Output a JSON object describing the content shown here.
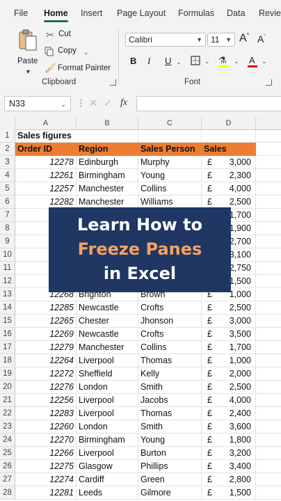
{
  "ribbon": {
    "tabs": [
      "File",
      "Home",
      "Insert",
      "Page Layout",
      "Formulas",
      "Data",
      "Review"
    ],
    "active_tab": "Home",
    "clipboard": {
      "paste_label": "Paste",
      "cut_label": "Cut",
      "copy_label": "Copy",
      "format_painter_label": "Format Painter",
      "group_label": "Clipboard"
    },
    "font": {
      "font_name": "Calibri",
      "font_size": "11",
      "group_label": "Font",
      "bold": "B",
      "italic": "I",
      "underline": "U",
      "grow": "A",
      "shrink": "A"
    }
  },
  "formula_bar": {
    "name_box": "N33",
    "fx": "fx",
    "formula": ""
  },
  "grid": {
    "columns": [
      "A",
      "B",
      "C",
      "D"
    ],
    "title": "Sales figures",
    "headers": [
      "Order ID",
      "Region",
      "Sales Person",
      "Sales"
    ],
    "currency_symbol": "£",
    "rows": [
      {
        "num": "3",
        "id": "12278",
        "region": "Edinburgh",
        "person": "Murphy",
        "sales": "3,000"
      },
      {
        "num": "4",
        "id": "12261",
        "region": "Birmingham",
        "person": "Young",
        "sales": "2,300"
      },
      {
        "num": "5",
        "id": "12257",
        "region": "Manchester",
        "person": "Collins",
        "sales": "4,000"
      },
      {
        "num": "6",
        "id": "12282",
        "region": "Manchester",
        "person": "Williams",
        "sales": "2,500"
      },
      {
        "num": "7",
        "id": "",
        "region": "",
        "person": "",
        "sales": "1,700"
      },
      {
        "num": "8",
        "id": "",
        "region": "",
        "person": "",
        "sales": "1,900"
      },
      {
        "num": "9",
        "id": "",
        "region": "",
        "person": "",
        "sales": "2,700"
      },
      {
        "num": "10",
        "id": "",
        "region": "",
        "person": "",
        "sales": "3,100"
      },
      {
        "num": "11",
        "id": "",
        "region": "",
        "person": "",
        "sales": "2,750"
      },
      {
        "num": "12",
        "id": "",
        "region": "",
        "person": "",
        "sales": "1,500"
      },
      {
        "num": "13",
        "id": "12268",
        "region": "Brighton",
        "person": "Brown",
        "sales": "1,000"
      },
      {
        "num": "14",
        "id": "12285",
        "region": "Newcastle",
        "person": "Crofts",
        "sales": "2,500"
      },
      {
        "num": "15",
        "id": "12265",
        "region": "Chester",
        "person": "Jhonson",
        "sales": "3,000"
      },
      {
        "num": "16",
        "id": "12269",
        "region": "Newcastle",
        "person": "Crofts",
        "sales": "3,500"
      },
      {
        "num": "17",
        "id": "12279",
        "region": "Manchester",
        "person": "Collins",
        "sales": "1,700"
      },
      {
        "num": "18",
        "id": "12264",
        "region": "Liverpool",
        "person": "Thomas",
        "sales": "1,000"
      },
      {
        "num": "19",
        "id": "12272",
        "region": "Sheffield",
        "person": "Kelly",
        "sales": "2,000"
      },
      {
        "num": "20",
        "id": "12276",
        "region": "London",
        "person": "Smith",
        "sales": "2,500"
      },
      {
        "num": "21",
        "id": "12256",
        "region": "Liverpool",
        "person": "Jacobs",
        "sales": "4,000"
      },
      {
        "num": "22",
        "id": "12283",
        "region": "Liverpool",
        "person": "Thomas",
        "sales": "2,400"
      },
      {
        "num": "23",
        "id": "12260",
        "region": "London",
        "person": "Smith",
        "sales": "3,600"
      },
      {
        "num": "24",
        "id": "12270",
        "region": "Birmingham",
        "person": "Young",
        "sales": "1,800"
      },
      {
        "num": "25",
        "id": "12266",
        "region": "Liverpool",
        "person": "Burton",
        "sales": "3,200"
      },
      {
        "num": "26",
        "id": "12275",
        "region": "Glasgow",
        "person": "Phillips",
        "sales": "3,400"
      },
      {
        "num": "27",
        "id": "12274",
        "region": "Cardiff",
        "person": "Green",
        "sales": "2,800"
      },
      {
        "num": "28",
        "id": "12281",
        "region": "Leeds",
        "person": "Gilmore",
        "sales": "1,500"
      }
    ]
  },
  "overlay": {
    "line1": "Learn How to",
    "line2": "Freeze Panes",
    "line3": "in Excel"
  },
  "colors": {
    "accent_green": "#1e7145",
    "header_orange": "#ed7d31",
    "overlay_navy": "#203764",
    "overlay_accent": "#f4a261"
  }
}
